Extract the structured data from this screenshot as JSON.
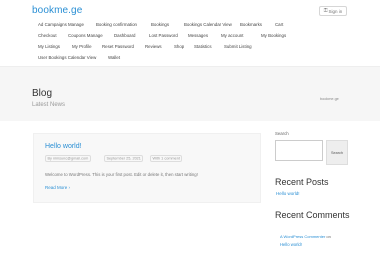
{
  "header": {
    "logo": "bookme.ge",
    "signin_icon": "key-icon",
    "signin_label": "Sign in"
  },
  "nav": {
    "row1": [
      "Ad Campaigns Manage",
      "Booking confirmation",
      "Bookings",
      "Bookings Calendar View",
      "Bookmarks",
      "Cart"
    ],
    "row2": [
      "Checkout",
      "Coupons Manage",
      "Dashboard",
      "Lost Password",
      "Messages",
      "My account",
      "My Bookings"
    ],
    "row3": [
      "My Listings",
      "My Profile",
      "Reset Password",
      "Reviews",
      "Shop",
      "Statistics",
      "Submit Listing"
    ],
    "row4": [
      "User Bookings Calendar View",
      "Wallet"
    ]
  },
  "page": {
    "title": "Blog",
    "subtitle": "Latest News",
    "breadcrumb": "bookme.ge"
  },
  "post": {
    "title": "Hello world!",
    "author": "By nimsunc@gmail.com",
    "date": "September 25, 2021",
    "comments": "With 1 comment",
    "excerpt": "Welcome to WordPress. This is your first post. Edit or delete it, then start writing!",
    "read_more": "Read More",
    "read_more_icon": "chevron-right-icon"
  },
  "sidebar": {
    "search_label": "Search",
    "search_placeholder": "",
    "search_button": "Search",
    "recent_posts_heading": "Recent Posts",
    "recent_posts": [
      "Hello world!"
    ],
    "recent_comments_heading": "Recent Comments",
    "comment_author": "A WordPress Commenter",
    "comment_on": "on",
    "comment_post": "Hello world!"
  }
}
